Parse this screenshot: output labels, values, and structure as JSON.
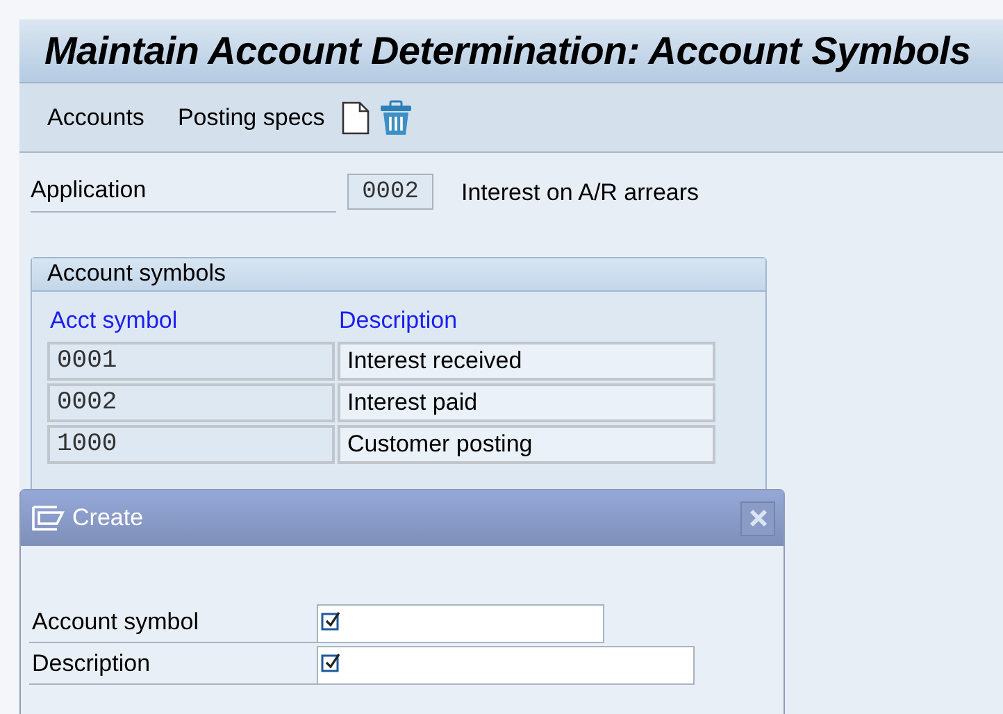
{
  "window": {
    "title": "Maintain Account Determination: Account Symbols"
  },
  "toolbar": {
    "items": [
      "Accounts",
      "Posting specs"
    ]
  },
  "application": {
    "label": "Application",
    "value": "0002",
    "description": "Interest on A/R arrears"
  },
  "account_symbols": {
    "title": "Account symbols",
    "columns": [
      "Acct symbol",
      "Description"
    ],
    "rows": [
      {
        "symbol": "0001",
        "description": "Interest received"
      },
      {
        "symbol": "0002",
        "description": "Interest paid"
      },
      {
        "symbol": "1000",
        "description": "Customer posting"
      }
    ]
  },
  "dialog": {
    "title": "Create",
    "fields": [
      {
        "label": "Account symbol",
        "required": true
      },
      {
        "label": "Description",
        "required": true
      }
    ]
  }
}
